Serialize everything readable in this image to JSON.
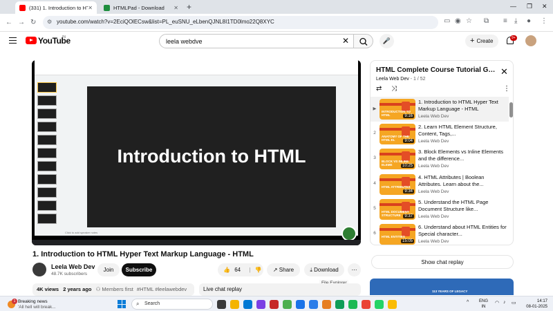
{
  "browser": {
    "tabs": [
      {
        "title": "(331) 1. Introduction to HTML",
        "active": true,
        "favicon_color": "#ff0000"
      },
      {
        "title": "HTMLPad - Download",
        "active": false,
        "favicon_color": "#1e8e3e"
      }
    ],
    "url": "youtube.com/watch?v=2EciQOlECsw&list=PL_euSNU_eLbenQJNL8I1TD0lmo22Q8XYC"
  },
  "youtube": {
    "logo_text": "YouTube",
    "country": "IN",
    "search_value": "leela webdve",
    "create_label": "Create",
    "notif_count": "9+"
  },
  "video": {
    "slide_title": "Introduction to HTML",
    "slide_notes": "Click to add speaker notes",
    "title": "1. Introduction to HTML Hyper Text Markup Language - HTML",
    "channel": "Leela Web Dev",
    "subscribers": "48.7K subscribers",
    "join_label": "Join",
    "subscribe_label": "Subscribe",
    "likes": "64",
    "share_label": "Share",
    "download_label": "Download",
    "tooltip": "File Explorer",
    "views": "4K views",
    "age": "2 years ago",
    "members": "Members first",
    "tags": "#HTML #leelawebdev",
    "live_chat": "Live chat replay"
  },
  "playlist": {
    "title": "HTML Complete Course Tutorial Gui...",
    "channel": "Leela Web Dev",
    "position": "1 / 52",
    "items": [
      {
        "num": "▶",
        "title": "1. Introduction to HTML Hyper Text Markup Language - HTML",
        "channel": "Leela Web Dev",
        "duration": "9:16",
        "thumb_text": "INTRODUCTION TO HTML"
      },
      {
        "num": "2",
        "title": "2. Learn HTML Element Structure, Content, Tags,...",
        "channel": "Leela Web Dev",
        "duration": "9:04",
        "thumb_text": "ANATOMY OF THE HTML EL"
      },
      {
        "num": "3",
        "title": "3. Block Elements vs Inline Elements and the difference...",
        "channel": "Leela Web Dev",
        "duration": "10:25",
        "thumb_text": "BLOCK VS INLINE ELEME"
      },
      {
        "num": "4",
        "title": "4. HTML Attributes | Boolean Attributes. Learn about the...",
        "channel": "Leela Web Dev",
        "duration": "9:34",
        "thumb_text": "HTML ATTRIBUTES"
      },
      {
        "num": "5",
        "title": "5. Understand the HTML Page Document Structure like...",
        "channel": "Leela Web Dev",
        "duration": "9:37",
        "thumb_text": "HTML DOCUMENT STRUCTURE"
      },
      {
        "num": "6",
        "title": "6. Understand about HTML Entities for Special character...",
        "channel": "Leela Web Dev",
        "duration": "15:05",
        "thumb_text": "HTML ENTITIES"
      }
    ],
    "show_chat_replay": "Show chat replay"
  },
  "ad": {
    "text": "113 YEARS OF LEGACY"
  },
  "taskbar": {
    "news_badge": "1",
    "news_title": "Breaking news",
    "news_sub": "'All hell will break...",
    "search_label": "Search",
    "lang_line1": "ENG",
    "lang_line2": "IN",
    "time": "14:17",
    "date": "08-01-2025",
    "app_colors": [
      "#3a3a3a",
      "#f4b400",
      "#0078d4",
      "#7b3fe4",
      "#c62828",
      "#4caf50",
      "#1a73e8",
      "#2b7de9",
      "#e67e22",
      "#0f9d58",
      "#1db954",
      "#ea4335",
      "#25d366",
      "#fbbc04"
    ]
  }
}
